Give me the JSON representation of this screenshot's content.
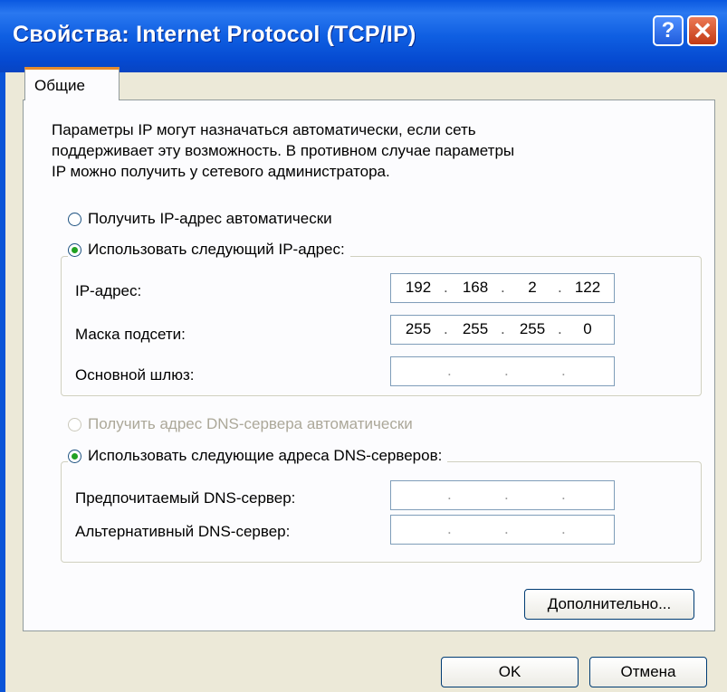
{
  "window": {
    "title": "Свойства: Internet Protocol (TCP/IP)",
    "help_glyph": "?",
    "close_glyph": "✕"
  },
  "tabs": [
    {
      "label": "Общие"
    }
  ],
  "description": [
    "Параметры IP могут назначаться автоматически, если сеть",
    "поддерживает эту возможность. В противном случае параметры",
    "IP можно получить у сетевого администратора."
  ],
  "ip_mode": {
    "auto": {
      "label": "Получить IP-адрес автоматически",
      "checked": false
    },
    "manual": {
      "label": "Использовать следующий IP-адрес:",
      "checked": true
    }
  },
  "ip_fields": {
    "ip_address": {
      "label": "IP-адрес:",
      "octets": [
        "192",
        "168",
        "2",
        "122"
      ]
    },
    "subnet_mask": {
      "label": "Маска подсети:",
      "octets": [
        "255",
        "255",
        "255",
        "0"
      ]
    },
    "gateway": {
      "label": "Основной шлюз:",
      "octets": [
        "",
        "",
        "",
        ""
      ]
    }
  },
  "dns_mode": {
    "auto": {
      "label": "Получить адрес DNS-сервера автоматически",
      "checked": false,
      "disabled": true
    },
    "manual": {
      "label": "Использовать следующие адреса DNS-серверов:",
      "checked": true
    }
  },
  "dns_fields": {
    "preferred": {
      "label": "Предпочитаемый DNS-сервер:",
      "octets": [
        "",
        "",
        "",
        ""
      ]
    },
    "alternate": {
      "label": "Альтернативный DNS-сервер:",
      "octets": [
        "",
        "",
        "",
        ""
      ]
    }
  },
  "buttons": {
    "advanced": "Дополнительно...",
    "ok": "OK",
    "cancel": "Отмена"
  },
  "colors": {
    "titlebar": "#0a58e0",
    "dialog_bg": "#ece9d8",
    "tab_accent": "#e68b2c",
    "radio_dot": "#21a121"
  }
}
